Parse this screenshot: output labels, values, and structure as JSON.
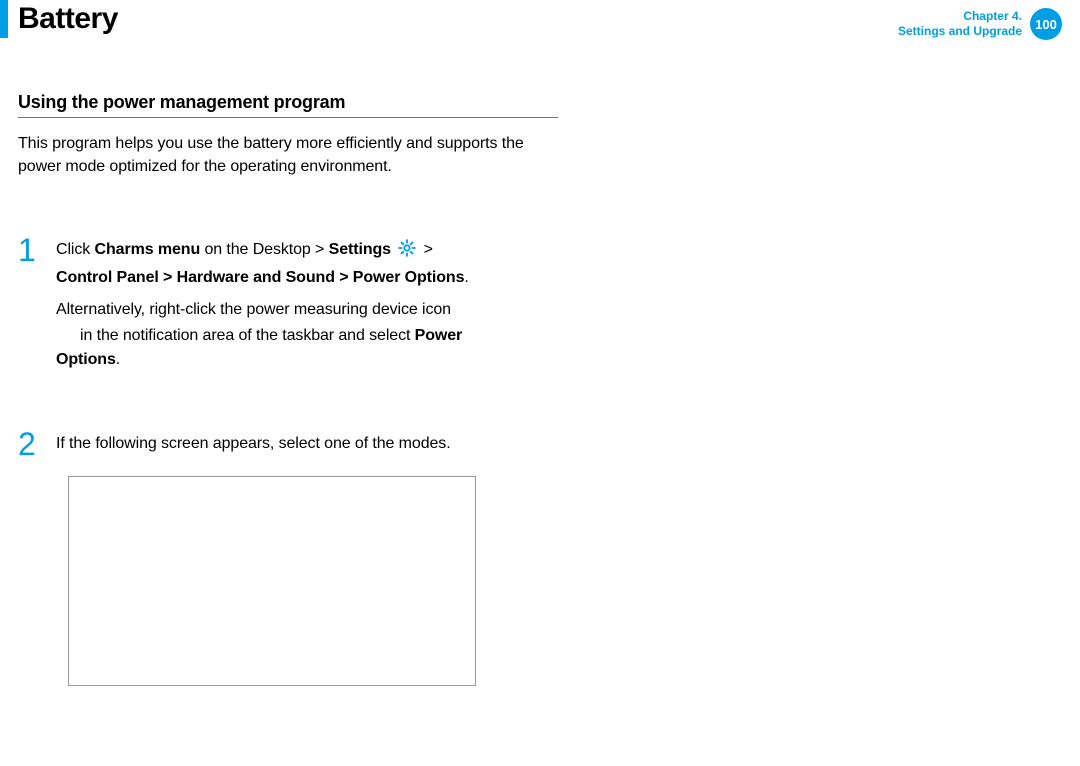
{
  "header": {
    "title": "Battery",
    "chapter_line1": "Chapter 4.",
    "chapter_line2": "Settings and Upgrade",
    "page_number": "100"
  },
  "section": {
    "heading": "Using the power management program",
    "intro": "This program helps you use the battery more efficiently and supports the power mode optimized for the operating environment."
  },
  "steps": {
    "s1": {
      "num": "1",
      "l1a": "Click ",
      "l1b": "Charms menu",
      "l1c": " on the Desktop > ",
      "l1d": "Settings",
      "l1e": " > ",
      "l2a": "Control Panel > Hardware and Sound > Power Options",
      "l2b": ".",
      "alt1": "Alternatively, right-click the power measuring device icon",
      "alt2a": "in the notification area of the taskbar and select ",
      "alt2b": "Power",
      "alt3a": "Options",
      "alt3b": "."
    },
    "s2": {
      "num": "2",
      "text": "If the following screen appears, select one of the modes."
    }
  }
}
